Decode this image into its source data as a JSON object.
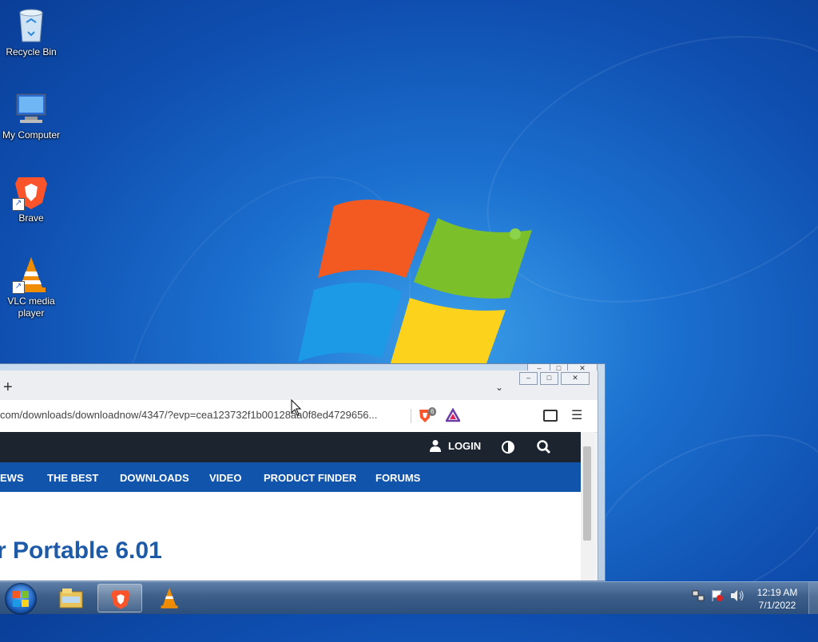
{
  "desktop": {
    "icons": [
      {
        "label": "Recycle Bin",
        "icon": "recycle-bin-icon"
      },
      {
        "label": "My Computer",
        "icon": "computer-icon"
      },
      {
        "label": "Brave",
        "icon": "brave-icon"
      },
      {
        "label": "VLC media player",
        "icon": "vlc-icon"
      }
    ]
  },
  "browser": {
    "new_tab": "+",
    "tab_dropdown": "⌄",
    "url": "com/downloads/downloadnow/4347/?evp=cea123732f1b00128aa0f8ed4729656...",
    "shield_count": "6",
    "menu": "☰",
    "site": {
      "login": "LOGIN",
      "nav": [
        "EWS",
        "THE BEST",
        "DOWNLOADS",
        "VIDEO",
        "PRODUCT FINDER",
        "FORUMS"
      ],
      "title": "r Portable 6.01"
    }
  },
  "taskbar": {
    "time": "12:19 AM",
    "date": "7/1/2022"
  },
  "colors": {
    "accent": "#1054ab",
    "site_header": "#1c2430",
    "title": "#1d5aa8"
  }
}
